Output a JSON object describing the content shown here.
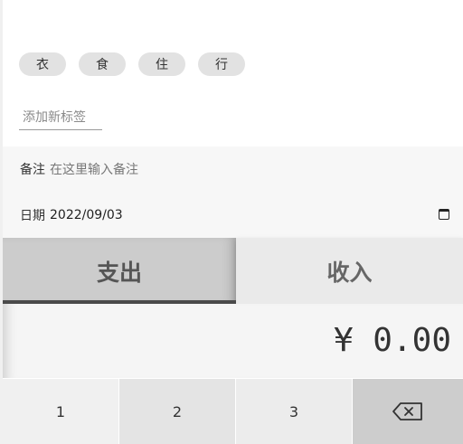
{
  "tags": [
    "衣",
    "食",
    "住",
    "行"
  ],
  "new_tag": {
    "placeholder": "添加新标签"
  },
  "note": {
    "label": "备注",
    "placeholder": "在这里输入备注"
  },
  "date": {
    "label": "日期",
    "value": "2022/09/03"
  },
  "tabs": {
    "expense": "支出",
    "income": "收入",
    "active": "expense"
  },
  "amount": {
    "display": "¥ 0.00"
  },
  "keypad": {
    "keys": [
      "1",
      "2",
      "3"
    ],
    "delete_icon": "backspace-icon"
  }
}
